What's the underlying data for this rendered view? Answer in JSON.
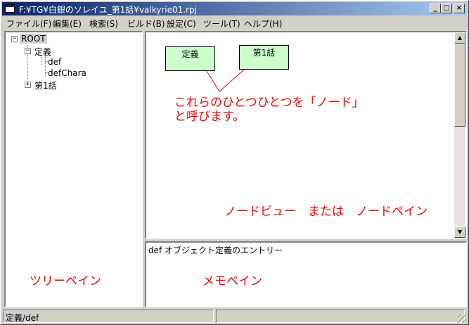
{
  "window": {
    "title": "F:¥TG¥白銀のソレイユ_第1話¥valkyrie01.rpj"
  },
  "title_buttons": {
    "minimize": "_",
    "maximize": "□",
    "close": "×"
  },
  "menu": [
    "ファイル(F)",
    "編集(E)",
    "検索(S)",
    "ビルド(B)",
    "設定(C)",
    "ツール(T)",
    "ヘルプ(H)"
  ],
  "tree": {
    "root": {
      "label": "ROOT",
      "expander": "−"
    },
    "teigi": {
      "label": "定義",
      "expander": "−"
    },
    "def": {
      "label": "def"
    },
    "defchara": {
      "label": "defChara"
    },
    "dai1wa": {
      "label": "第1話",
      "expander": "+"
    }
  },
  "nodes": [
    "定義",
    "第1話"
  ],
  "annotations": {
    "node_line1": "これらのひとつひとつを「ノード」",
    "node_line2": "と呼びます。",
    "nodeview": "ノードビュー　または　ノードペイン",
    "treepane": "ツリーペイン",
    "memopane": "メモペイン"
  },
  "memo": {
    "text": "def オブジェクト定義のエントリー"
  },
  "status": {
    "path": "定義/def"
  },
  "colors": {
    "node_fill": "#ccffcc",
    "annotation": "#ff0000",
    "title_start": "#0a246a"
  }
}
